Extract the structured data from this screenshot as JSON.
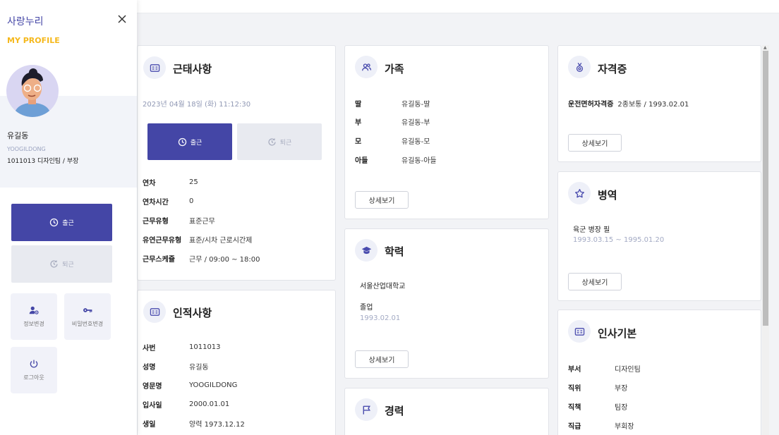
{
  "panel": {
    "app_title": "사랑누리",
    "section_title": "MY PROFILE",
    "name": "유길동",
    "name_en": "YOOGILDONG",
    "dept_line": "1011013 디자인팀 / 부장",
    "clock_in": "출근",
    "clock_out": "퇴근",
    "tiles": [
      "정보변경",
      "비밀번호변경",
      "로그아웃"
    ]
  },
  "attendance": {
    "title": "근태사항",
    "datetime": "2023년 04월 18일 (화) 11:12:30",
    "clock_in": "출근",
    "clock_out": "퇴근",
    "rows": [
      {
        "k": "연차",
        "v": "25"
      },
      {
        "k": "연차시간",
        "v": "0"
      },
      {
        "k": "근무유형",
        "v": "표준근무"
      },
      {
        "k": "유연근무유형",
        "v": "표준/시차 근로시간제"
      },
      {
        "k": "근무스케쥴",
        "v": "근무 / 09:00 ~ 18:00"
      }
    ]
  },
  "personal": {
    "title": "인적사항",
    "rows": [
      {
        "k": "사번",
        "v": "1011013"
      },
      {
        "k": "성명",
        "v": "유길동"
      },
      {
        "k": "영문명",
        "v": "YOOGILDONG"
      },
      {
        "k": "입사일",
        "v": "2000.01.01"
      },
      {
        "k": "생일",
        "v": "양력 1973.12.12"
      }
    ]
  },
  "family": {
    "title": "가족",
    "rows": [
      {
        "k": "딸",
        "v": "유길동-딸"
      },
      {
        "k": "부",
        "v": "유길동-부"
      },
      {
        "k": "모",
        "v": "유길동-모"
      },
      {
        "k": "아들",
        "v": "유길동-아들"
      }
    ],
    "detail": "상세보기"
  },
  "education": {
    "title": "학력",
    "school": "서울산업대학교",
    "status": "졸업",
    "date": "1993.02.01",
    "detail": "상세보기"
  },
  "career": {
    "title": "경력"
  },
  "license": {
    "title": "자격증",
    "name": "운전면허자격증",
    "value": "2종보통 / 1993.02.01",
    "detail": "상세보기"
  },
  "military": {
    "title": "병역",
    "line": "육군 병장 필",
    "period": "1993.03.15 ~ 1995.01.20",
    "detail": "상세보기"
  },
  "hr": {
    "title": "인사기본",
    "rows": [
      {
        "k": "부서",
        "v": "디자인팀"
      },
      {
        "k": "직위",
        "v": "부장"
      },
      {
        "k": "직책",
        "v": "팀장"
      },
      {
        "k": "직급",
        "v": "부회장"
      }
    ]
  },
  "colors": {
    "accent": "#4446a6",
    "highlight": "#f5b81c"
  }
}
